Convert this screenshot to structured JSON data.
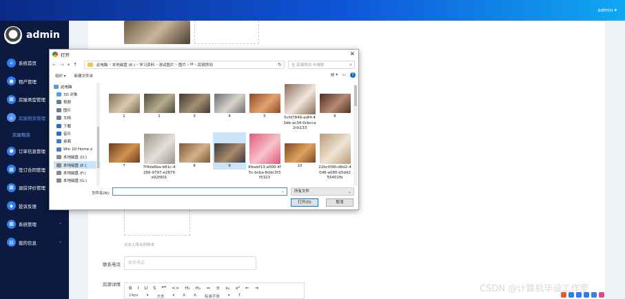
{
  "topbar": {
    "user_label": "admin ▾"
  },
  "brand": {
    "name": "admin"
  },
  "menu": [
    {
      "label": "系统首页",
      "icon": "home-icon",
      "glyph": "⌂",
      "has_chevron": false
    },
    {
      "label": "租户管理",
      "icon": "user-icon",
      "glyph": "●",
      "has_chevron": true
    },
    {
      "label": "房屋类型管理",
      "icon": "grid-icon",
      "glyph": "▦",
      "has_chevron": true
    },
    {
      "label": "房屋租赁管理",
      "icon": "house-icon",
      "glyph": "⌂",
      "has_chevron": true,
      "active": true
    }
  ],
  "menu_sub": {
    "label": "房屋租赁"
  },
  "menu_after": [
    {
      "label": "订单信息管理",
      "icon": "user-icon",
      "glyph": "●",
      "has_chevron": true
    },
    {
      "label": "签订合同管理",
      "icon": "contract-icon",
      "glyph": "▦",
      "has_chevron": true
    },
    {
      "label": "退房评价管理",
      "icon": "comment-icon",
      "glyph": "▦",
      "has_chevron": true
    },
    {
      "label": "投诉反馈",
      "icon": "shield-icon",
      "glyph": "◆",
      "has_chevron": false
    },
    {
      "label": "系统管理",
      "icon": "settings-icon",
      "glyph": "▦",
      "has_chevron": true
    },
    {
      "label": "我的信息",
      "icon": "info-icon",
      "glyph": "▤",
      "has_chevron": true
    }
  ],
  "form": {
    "upload_hint": "点击上传合同样本",
    "phone_label": "联系电话",
    "phone_placeholder": "联系电话",
    "detail_label": "房源详情",
    "editor_row1": [
      "B",
      "I",
      "U",
      "S",
      "❝❞",
      "<>",
      "H₁",
      "H₂",
      "≔",
      "≡",
      "x₂",
      "x²",
      "⇤",
      "⇥"
    ],
    "editor_row2": [
      "14px",
      "▾",
      "文本",
      "▾",
      "A",
      "A",
      "标准字体",
      "▾",
      "T"
    ]
  },
  "dialog": {
    "title": "打开",
    "nav": [
      "←",
      "→",
      "▾",
      "↑"
    ],
    "path": [
      "此电脑",
      "›",
      "本地磁盘 (E:)",
      "›",
      "学习资料",
      "›",
      "测试图片",
      "›",
      "图片",
      "›",
      "M",
      "›",
      "民宿房间"
    ],
    "search_placeholder": "在 民宿房间 中搜索",
    "toolbar": {
      "organize": "组织 ▾",
      "new_folder": "新建文件夹"
    },
    "tree": [
      {
        "label": "此电脑",
        "color": "#5a9bd5"
      },
      {
        "label": "3D 对象",
        "color": "#49a6d9"
      },
      {
        "label": "视频",
        "color": "#6b7c93"
      },
      {
        "label": "图片",
        "color": "#6b7c93"
      },
      {
        "label": "文档",
        "color": "#6b7c93"
      },
      {
        "label": "下载",
        "color": "#2c6fc0"
      },
      {
        "label": "音乐",
        "color": "#2c6fc0"
      },
      {
        "label": "桌面",
        "color": "#3c7fd0"
      },
      {
        "label": "Win 10 Home x",
        "color": "#3c7fd0"
      },
      {
        "label": "本地磁盘 (D:)",
        "color": "#888888"
      },
      {
        "label": "本地磁盘 (E:)",
        "color": "#888888",
        "selected": true
      },
      {
        "label": "本地磁盘 (F:)",
        "color": "#888888"
      },
      {
        "label": "本地磁盘 (G:)",
        "color": "#888888"
      }
    ],
    "files": [
      {
        "name": "1",
        "c1": "#7a6a58",
        "c2": "#d9c9ae"
      },
      {
        "name": "2",
        "c1": "#4d4a3c",
        "c2": "#b7ab8c"
      },
      {
        "name": "3",
        "c1": "#3f3a34",
        "c2": "#a48f73"
      },
      {
        "name": "4",
        "c1": "#6e6e72",
        "c2": "#d7d2cc"
      },
      {
        "name": "5",
        "c1": "#8a4a2c",
        "c2": "#e3a36e"
      },
      {
        "name": "5cfd7849-adf4-43db-ac34-0cbcca2cb133",
        "c1": "#8d6b55",
        "c2": "#efe7df"
      },
      {
        "name": "6",
        "c1": "#4a3126",
        "c2": "#b78a74"
      },
      {
        "name": "7",
        "c1": "#6a3d20",
        "c2": "#d0924f"
      },
      {
        "name": "7f4da6ba-b81c-4266-9797-e2879e92f901",
        "c1": "#9b948c",
        "c2": "#e5e0d9"
      },
      {
        "name": "8",
        "c1": "#7b5a3c",
        "c2": "#d5b18a"
      },
      {
        "name": "9",
        "c1": "#3b3a3a",
        "c2": "#a88a6c",
        "selected": true
      },
      {
        "name": "9feabf13-e000-4f5c-bcba-6ddc3f3f5323",
        "c1": "#e05a78",
        "c2": "#f6c2cc"
      },
      {
        "name": "10",
        "c1": "#7a4a22",
        "c2": "#e0a260"
      },
      {
        "name": "22bc0f90-d6d2-40d6-a080-b5dd255401fb",
        "c1": "#b79c78",
        "c2": "#efe4d4"
      }
    ],
    "filename_label": "文件名(N):",
    "filename_value": "",
    "filetype": "所有文件",
    "open_button": "打开(O)",
    "cancel_button": "取消"
  },
  "watermark": "CSDN @计算机毕设工作室"
}
